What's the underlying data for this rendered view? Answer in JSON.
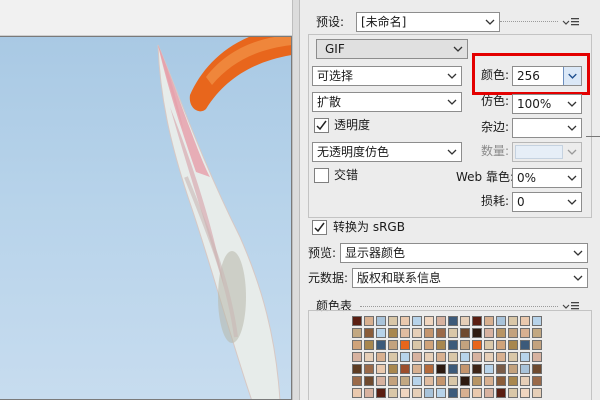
{
  "settings": {
    "preset_label": "预设:",
    "preset_value": "[未命名]",
    "format_value": "GIF",
    "reduction_value": "可选择",
    "dither_method_value": "扩散",
    "transparency_label": "透明度",
    "transparency_checked": true,
    "trans_dither_value": "无透明度仿色",
    "interlaced_label": "交错",
    "interlaced_checked": false,
    "colors_label": "颜色:",
    "colors_value": "256",
    "dither_label": "仿色:",
    "dither_value": "100%",
    "matte_label": "杂边:",
    "matte_value": "",
    "amount_label": "数量:",
    "amount_value": "",
    "web_snap_label": "Web 靠色:",
    "web_snap_value": "0%",
    "lossy_label": "损耗:",
    "lossy_value": "0",
    "convert_srgb_label": "转换为 sRGB",
    "convert_srgb_checked": true,
    "preview_label": "预览:",
    "preview_value": "显示器颜色",
    "metadata_label": "元数据:",
    "metadata_value": "版权和联系信息",
    "color_table_label": "颜色表"
  },
  "colors": {
    "highlight": "#e30000",
    "selected_field": "#dbe8f7",
    "flower_orange": "#e8661c",
    "sky": "#b7d3ea"
  },
  "icons": [
    "chevron-down-icon",
    "panel-menu-icon",
    "checkmark-icon"
  ]
}
